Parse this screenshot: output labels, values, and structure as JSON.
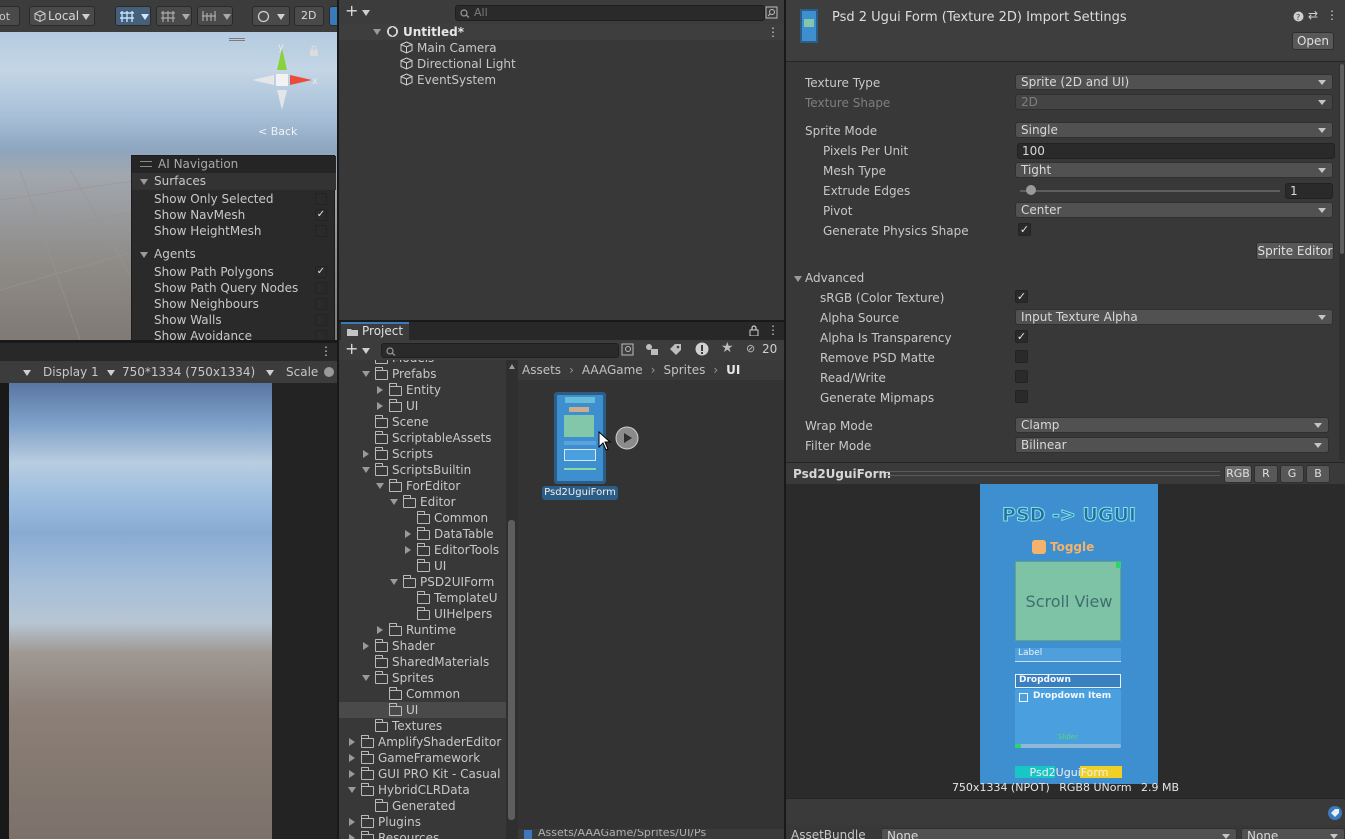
{
  "scene_toolbar": {
    "local_label": "Local",
    "mode_2d": "2D",
    "back_label": "Back",
    "gizmo_y": "y",
    "gizmo_x": "x"
  },
  "ai_navigation": {
    "title": "AI Navigation",
    "surfaces_header": "Surfaces",
    "surfaces": [
      {
        "label": "Show Only Selected",
        "checked": false
      },
      {
        "label": "Show NavMesh",
        "checked": true
      },
      {
        "label": "Show HeightMesh",
        "checked": false
      }
    ],
    "agents_header": "Agents",
    "agents": [
      {
        "label": "Show Path Polygons",
        "checked": true
      },
      {
        "label": "Show Path Query Nodes",
        "checked": false
      },
      {
        "label": "Show Neighbours",
        "checked": false
      },
      {
        "label": "Show Walls",
        "checked": false
      },
      {
        "label": "Show Avoidance",
        "checked": false
      }
    ]
  },
  "game_toolbar": {
    "display": "Display 1",
    "resolution": "750*1334 (750x1334)",
    "scale": "Scale"
  },
  "hierarchy": {
    "search_placeholder": "All",
    "scene_name": "Untitled*",
    "items": [
      "Main Camera",
      "Directional Light",
      "EventSystem"
    ]
  },
  "project": {
    "tab_title": "Project",
    "hidden_count": "20",
    "tree": [
      {
        "label": "Models",
        "indent": 0,
        "arrow": "none"
      },
      {
        "label": "Prefabs",
        "indent": 0,
        "arrow": "down"
      },
      {
        "label": "Entity",
        "indent": 1,
        "arrow": "right"
      },
      {
        "label": "UI",
        "indent": 1,
        "arrow": "right"
      },
      {
        "label": "Scene",
        "indent": 0,
        "arrow": "none"
      },
      {
        "label": "ScriptableAssets",
        "indent": 0,
        "arrow": "none"
      },
      {
        "label": "Scripts",
        "indent": 0,
        "arrow": "right"
      },
      {
        "label": "ScriptsBuiltin",
        "indent": 0,
        "arrow": "down"
      },
      {
        "label": "ForEditor",
        "indent": 1,
        "arrow": "down"
      },
      {
        "label": "Editor",
        "indent": 2,
        "arrow": "down"
      },
      {
        "label": "Common",
        "indent": 3,
        "arrow": "none"
      },
      {
        "label": "DataTable",
        "indent": 3,
        "arrow": "right"
      },
      {
        "label": "EditorTools",
        "indent": 3,
        "arrow": "right"
      },
      {
        "label": "UI",
        "indent": 3,
        "arrow": "none"
      },
      {
        "label": "PSD2UIForm",
        "indent": 2,
        "arrow": "down"
      },
      {
        "label": "TemplateU",
        "indent": 3,
        "arrow": "none"
      },
      {
        "label": "UIHelpers",
        "indent": 3,
        "arrow": "none"
      },
      {
        "label": "Runtime",
        "indent": 1,
        "arrow": "right"
      },
      {
        "label": "Shader",
        "indent": 0,
        "arrow": "right"
      },
      {
        "label": "SharedMaterials",
        "indent": 0,
        "arrow": "none"
      },
      {
        "label": "Sprites",
        "indent": 0,
        "arrow": "down"
      },
      {
        "label": "Common",
        "indent": 1,
        "arrow": "none"
      },
      {
        "label": "UI",
        "indent": 1,
        "arrow": "none",
        "selected": true
      },
      {
        "label": "Textures",
        "indent": 0,
        "arrow": "none"
      },
      {
        "label": "AmplifyShaderEditor",
        "indent": -1,
        "arrow": "right"
      },
      {
        "label": "GameFramework",
        "indent": -1,
        "arrow": "right"
      },
      {
        "label": "GUI PRO Kit - Casual",
        "indent": -1,
        "arrow": "right"
      },
      {
        "label": "HybridCLRData",
        "indent": -1,
        "arrow": "down"
      },
      {
        "label": "Generated",
        "indent": 0,
        "arrow": "none"
      },
      {
        "label": "Plugins",
        "indent": -1,
        "arrow": "right"
      },
      {
        "label": "Resources",
        "indent": -1,
        "arrow": "right"
      }
    ],
    "breadcrumb": [
      "Assets",
      "AAAGame",
      "Sprites",
      "UI"
    ],
    "asset_name": "Psd2UguiForm",
    "path_footer": "Assets/AAAGame/Sprites/UI/Ps"
  },
  "inspector": {
    "title": "Psd 2 Ugui Form (Texture 2D) Import Settings",
    "open_button": "Open",
    "texture_type_label": "Texture Type",
    "texture_type": "Sprite (2D and UI)",
    "texture_shape_label": "Texture Shape",
    "texture_shape": "2D",
    "sprite_mode_label": "Sprite Mode",
    "sprite_mode": "Single",
    "ppu_label": "Pixels Per Unit",
    "ppu": "100",
    "mesh_type_label": "Mesh Type",
    "mesh_type": "Tight",
    "extrude_label": "Extrude Edges",
    "extrude": "1",
    "extrude_fraction": 0.0,
    "pivot_label": "Pivot",
    "pivot": "Center",
    "physics_label": "Generate Physics Shape",
    "physics_checked": true,
    "sprite_editor_button": "Sprite Editor",
    "advanced_label": "Advanced",
    "srgb_label": "sRGB (Color Texture)",
    "srgb_checked": true,
    "alpha_source_label": "Alpha Source",
    "alpha_source": "Input Texture Alpha",
    "alpha_transparency_label": "Alpha Is Transparency",
    "alpha_transparency_checked": true,
    "remove_matte_label": "Remove PSD Matte",
    "read_write_label": "Read/Write",
    "mipmaps_label": "Generate Mipmaps",
    "wrap_label": "Wrap Mode",
    "wrap": "Clamp",
    "filter_label": "Filter Mode",
    "filter": "Bilinear"
  },
  "preview": {
    "name": "Psd2UguiForm",
    "channels": [
      "RGB",
      "R",
      "G",
      "B"
    ],
    "image": {
      "title": "PSD -> UGUI",
      "toggle": "Toggle",
      "scroll_view": "Scroll View",
      "label": "Label",
      "dropdown": "Dropdown",
      "dropdown_item": "Dropdown Item",
      "slider": "Slider",
      "caption": "Psd2UguiForm"
    },
    "info_dims": "750x1334 (NPOT)",
    "info_format": "RGB8 UNorm",
    "info_size": "2.9 MB"
  },
  "asset_bundle": {
    "label": "AssetBundle",
    "value1": "None",
    "value2": "None"
  },
  "colors": {
    "selection": "#2c5d87",
    "unity_blue": "#3a79bb",
    "sprite_bg": "#3d8fd0"
  }
}
